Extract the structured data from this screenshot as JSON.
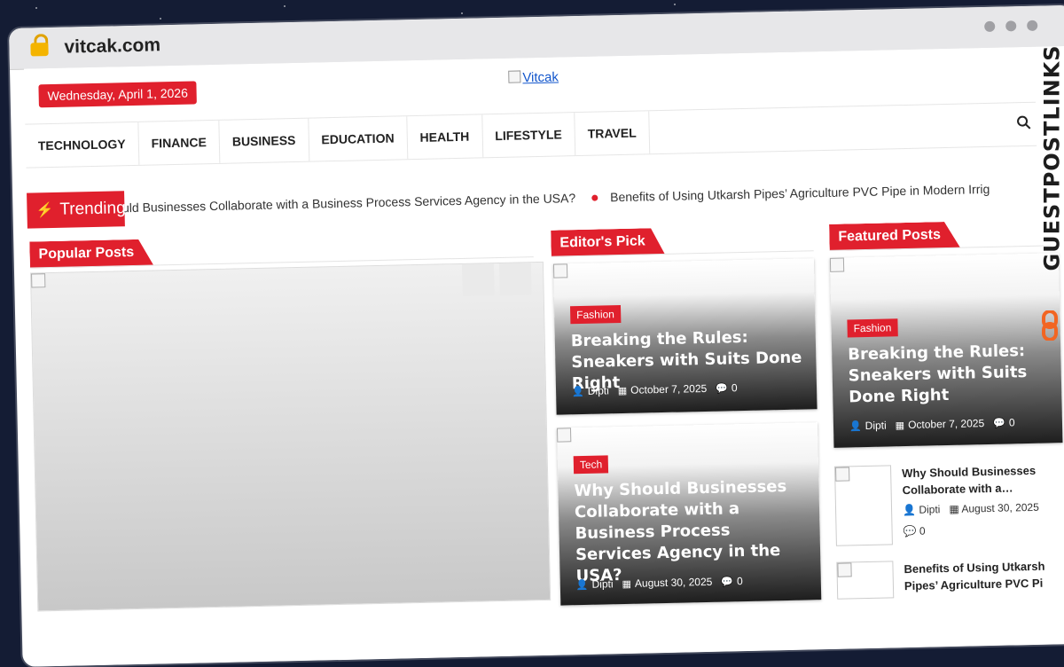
{
  "browser": {
    "url": "vitcak.com"
  },
  "header": {
    "date": "Wednesday, April 1, 2026",
    "logo_alt": "Vitcak"
  },
  "nav": {
    "items": [
      "TECHNOLOGY",
      "FINANCE",
      "BUSINESS",
      "EDUCATION",
      "HEALTH",
      "LIFESTYLE",
      "TRAVEL"
    ]
  },
  "trending": {
    "label": "Trending",
    "items": [
      "hould Businesses Collaborate with a Business Process Services Agency in the USA?",
      "Benefits of Using Utkarsh Pipes’ Agriculture PVC Pipe in Modern Irrig"
    ]
  },
  "sections": {
    "popular": "Popular Posts",
    "editors_pick": "Editor's Pick",
    "featured": "Featured Posts"
  },
  "editors_pick": [
    {
      "category": "Fashion",
      "title": "Breaking the Rules: Sneakers with Suits Done Right",
      "author": "Dipti",
      "date": "October 7, 2025",
      "comments": "0"
    },
    {
      "category": "Tech",
      "title": "Why Should Businesses Collaborate with a Business Process Services Agency in the USA?",
      "author": "Dipti",
      "date": "August 30, 2025",
      "comments": "0"
    }
  ],
  "featured": {
    "main": {
      "category": "Fashion",
      "title": "Breaking the Rules: Sneakers with Suits Done Right",
      "author": "Dipti",
      "date": "October 7, 2025",
      "comments": "0"
    },
    "list": [
      {
        "title": "Why Should Businesses Collaborate with a…",
        "author": "Dipti",
        "date": "August 30, 2025",
        "comments": "0"
      },
      {
        "title": "Benefits of Using Utkarsh Pipes’ Agriculture PVC Pi",
        "author": "",
        "date": "",
        "comments": ""
      }
    ]
  },
  "brand": {
    "name": "GUESTPOSTLINKS"
  },
  "colors": {
    "accent": "#e0202d",
    "background": "#141c34"
  }
}
